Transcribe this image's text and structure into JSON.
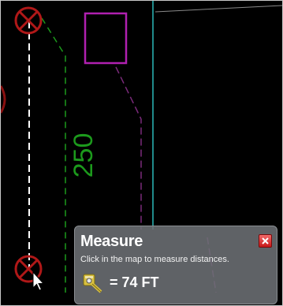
{
  "map": {
    "parcel_label": "250",
    "colors": {
      "background": "#000000",
      "dimension_line": "#1c9a1c",
      "parcel_outline": "#7a2a7a",
      "highlight_square": "#b020b0",
      "cyan_line": "#2bb8b8",
      "marker": "#b01818",
      "measure_line": "#ffffff"
    }
  },
  "measure_panel": {
    "title": "Measure",
    "instruction": "Click in the map to measure distances.",
    "result": "= 74 FT",
    "tool_icon": "measure-tool-icon",
    "close_icon": "close-icon"
  },
  "cursor": "arrow-cursor-icon"
}
